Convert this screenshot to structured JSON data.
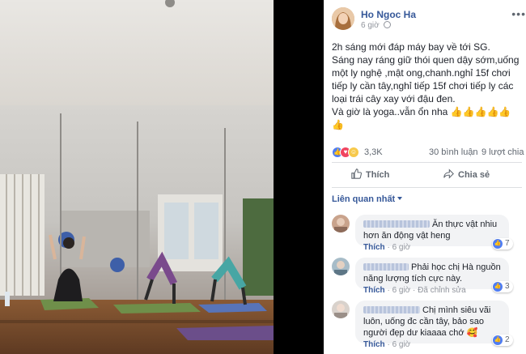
{
  "post": {
    "author": "Ho Ngoc Ha",
    "time": "6 giờ",
    "more": "•••",
    "paragraphs": [
      "2h sáng mới đáp máy bay về tới SG.",
      "Sáng nay ráng giữ thói quen dậy sớm,uống một ly nghệ ,mật ong,chanh.nghỉ 15f chơi tiếp ly cần tây,nghỉ tiếp 15f chơi tiếp ly các loại trái cây xay với đậu đen.",
      "Và giờ là yoga..vẫn ổn nha 👍👍👍👍👍👍"
    ]
  },
  "reactions": {
    "count": "3,3K",
    "comments": "30 bình luận",
    "shares": "9 lượt chia sẻ",
    "icons": [
      "like-icon",
      "love-icon",
      "haha-icon"
    ],
    "colors": {
      "like": "#4f7df3",
      "love": "#f0445f",
      "haha": "#f7c94b"
    }
  },
  "actions": {
    "like": "Thích",
    "share": "Chia sẻ"
  },
  "sort_label": "Liên quan nhất",
  "comments": [
    {
      "text": "Ăn thực vật nhiu hơn ăn động vật heng",
      "actions": [
        "Thích",
        "6 giờ"
      ],
      "reactions": "7"
    },
    {
      "text": "Phải học chị Hà nguồn năng lượng tích cực này.",
      "actions": [
        "Thích",
        "6 giờ",
        "Đã chỉnh sửa"
      ],
      "reactions": "3"
    },
    {
      "text": "Chị mình siêu vãi luôn, uống đc cần tây, bảo sao người đẹp dư kiaaaa chớ 🥰",
      "actions": [
        "Thích",
        "6 giờ"
      ],
      "reactions": "2"
    }
  ],
  "colors": {
    "link": "#365899",
    "text": "#1d2129",
    "muted": "#90949c",
    "bubble": "#f2f3f5"
  }
}
